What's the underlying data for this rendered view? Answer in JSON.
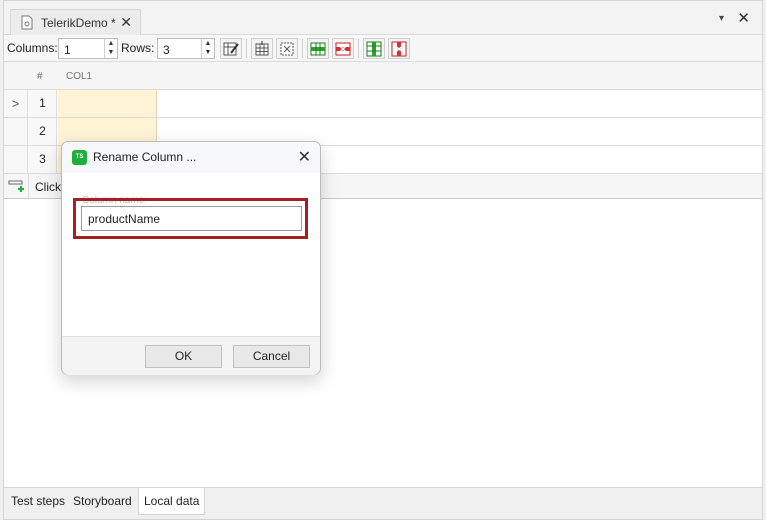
{
  "tab": {
    "title": "TelerikDemo *",
    "close": "✕"
  },
  "window": {
    "pin": "▾",
    "close": "✕"
  },
  "toolbar": {
    "columns_label": "Columns:",
    "columns_value": "1",
    "rows_label": "Rows:",
    "rows_value": "3"
  },
  "grid": {
    "row_header": "#",
    "columns": [
      "COL1"
    ],
    "rows": [
      {
        "num": "1",
        "selector": ">"
      },
      {
        "num": "2",
        "selector": ""
      },
      {
        "num": "3",
        "selector": ""
      }
    ],
    "add_row_text": "Click"
  },
  "dialog": {
    "icon_text": "TS",
    "title": "Rename Column ...",
    "close": "✕",
    "field_label": "Column name:",
    "field_value": "productName",
    "ok_label": "OK",
    "cancel_label": "Cancel"
  },
  "bottom_tabs": [
    "Test steps",
    "Storyboard",
    "Local data"
  ],
  "active_bottom_tab": "Local data",
  "colors": {
    "highlight": "#a31f22",
    "cell_fill": "#fff3d6",
    "ts_icon": "#1fae3a"
  }
}
